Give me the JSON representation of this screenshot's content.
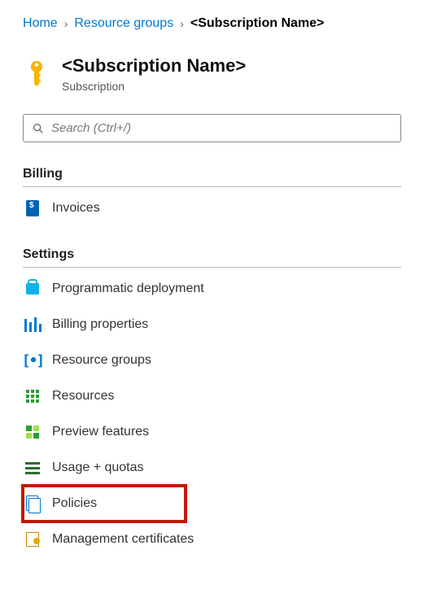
{
  "breadcrumb": {
    "home": "Home",
    "resource_groups": "Resource groups",
    "current": "<Subscription Name>"
  },
  "header": {
    "title": "<Subscription Name>",
    "subtitle": "Subscription"
  },
  "search": {
    "placeholder": "Search (Ctrl+/)"
  },
  "sections": {
    "billing": {
      "title": "Billing",
      "invoices": "Invoices"
    },
    "settings": {
      "title": "Settings",
      "programmatic": "Programmatic deployment",
      "billing_props": "Billing properties",
      "resource_groups": "Resource groups",
      "resources": "Resources",
      "preview": "Preview features",
      "usage": "Usage + quotas",
      "policies": "Policies",
      "mgmt_certs": "Management certificates"
    }
  }
}
